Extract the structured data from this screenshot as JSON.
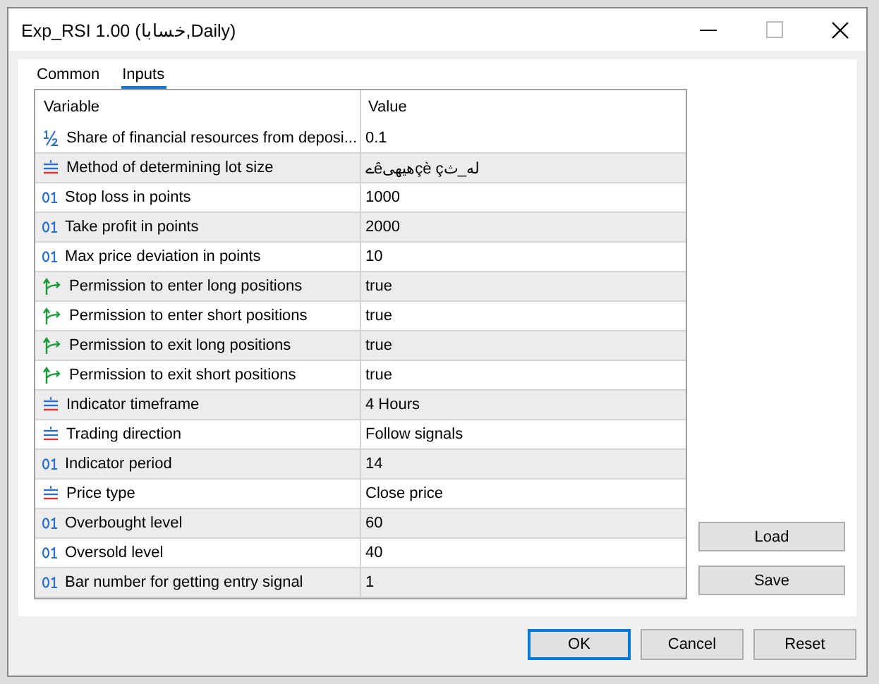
{
  "window": {
    "title": "Exp_RSI 1.00 (خسابا,Daily)"
  },
  "tabs": [
    {
      "label": "Common",
      "selected": false
    },
    {
      "label": "Inputs",
      "selected": true
    }
  ],
  "table": {
    "columns": [
      "Variable",
      "Value"
    ],
    "rows": [
      {
        "kind": "double",
        "variable": "Share of financial resources from deposi...",
        "value": "0.1"
      },
      {
        "kind": "enum",
        "variable": "Method of determining lot size",
        "value": "ےêهيهىçè çله_ث"
      },
      {
        "kind": "int",
        "variable": "Stop loss in points",
        "value": "1000"
      },
      {
        "kind": "int",
        "variable": "Take profit in points",
        "value": "2000"
      },
      {
        "kind": "int",
        "variable": "Max price deviation in points",
        "value": "10"
      },
      {
        "kind": "bool",
        "variable": "Permission to enter long positions",
        "value": "true"
      },
      {
        "kind": "bool",
        "variable": "Permission to enter short positions",
        "value": "true"
      },
      {
        "kind": "bool",
        "variable": "Permission to exit long positions",
        "value": "true"
      },
      {
        "kind": "bool",
        "variable": "Permission to exit short positions",
        "value": "true"
      },
      {
        "kind": "enum",
        "variable": "Indicator timeframe",
        "value": "4 Hours"
      },
      {
        "kind": "enum",
        "variable": "Trading direction",
        "value": "Follow signals"
      },
      {
        "kind": "int",
        "variable": "Indicator period",
        "value": "14"
      },
      {
        "kind": "enum",
        "variable": "Price type",
        "value": "Close price"
      },
      {
        "kind": "int",
        "variable": "Overbought level",
        "value": "60"
      },
      {
        "kind": "int",
        "variable": "Oversold level",
        "value": "40"
      },
      {
        "kind": "int",
        "variable": "Bar number for getting entry signal",
        "value": "1"
      }
    ]
  },
  "side_buttons": [
    "Load",
    "Save"
  ],
  "buttons": [
    {
      "label": "OK",
      "default": true
    },
    {
      "label": "Cancel",
      "default": false
    },
    {
      "label": "Reset",
      "default": false
    }
  ]
}
